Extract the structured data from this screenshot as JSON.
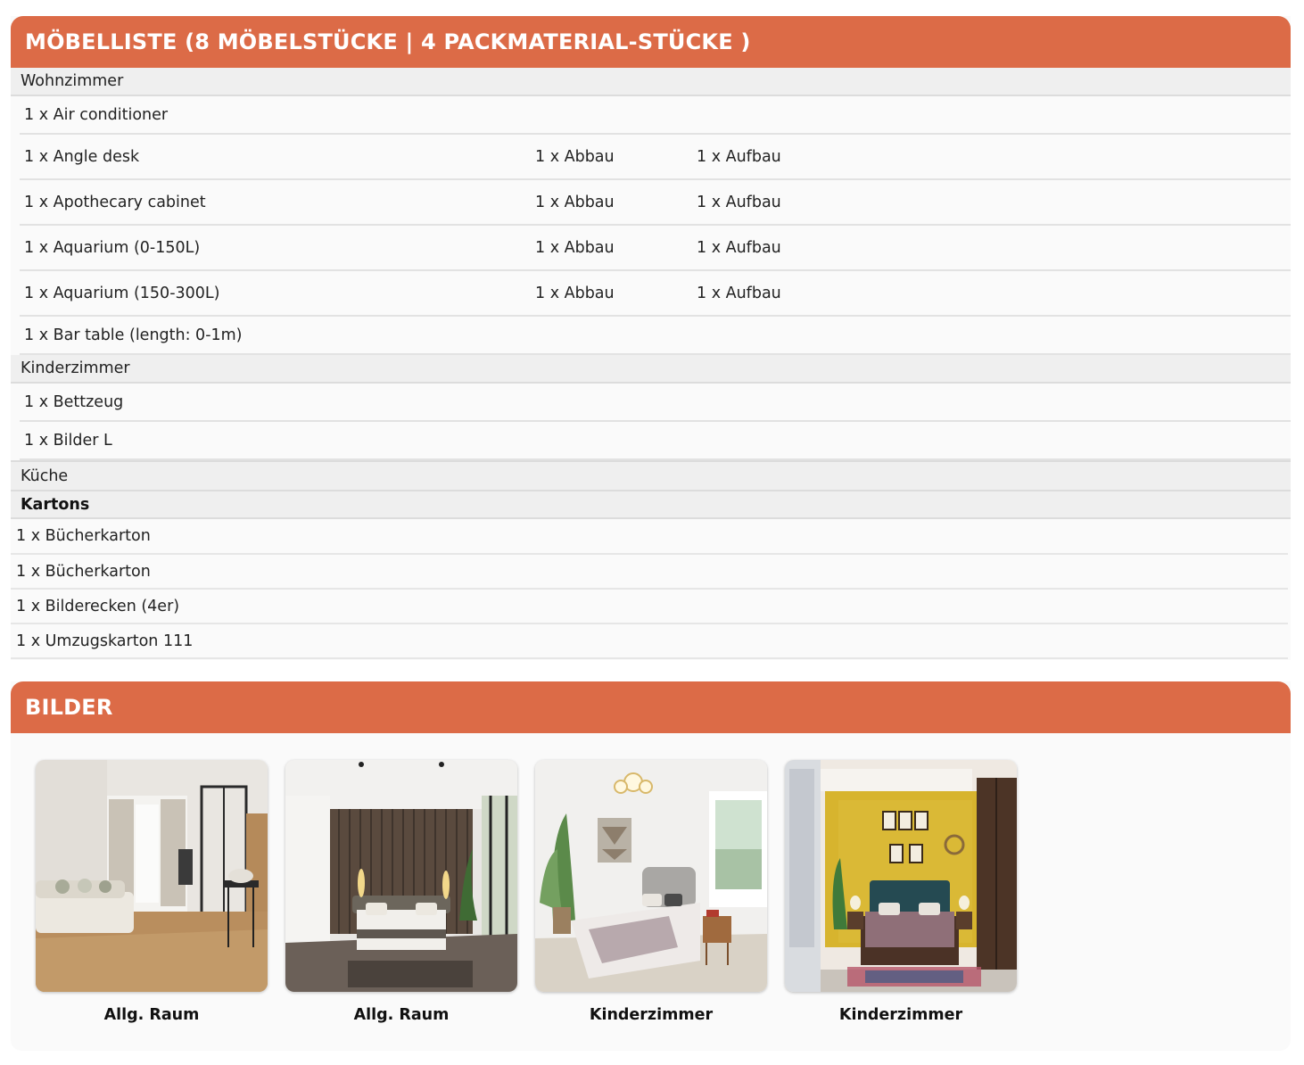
{
  "moebelliste": {
    "title": "MÖBELLISTE (8 MÖBELSTÜCKE | 4 PACKMATERIAL-STÜCKE )",
    "rooms": [
      {
        "name": "Wohnzimmer",
        "items": [
          {
            "label": "1 x Air conditioner",
            "abbau": "",
            "aufbau": ""
          },
          {
            "label": "1 x Angle desk",
            "abbau": "1 x Abbau",
            "aufbau": "1 x Aufbau"
          },
          {
            "label": "1 x Apothecary cabinet",
            "abbau": "1 x Abbau",
            "aufbau": "1 x Aufbau"
          },
          {
            "label": "1 x Aquarium (0-150L)",
            "abbau": "1 x Abbau",
            "aufbau": "1 x Aufbau"
          },
          {
            "label": "1 x Aquarium (150-300L)",
            "abbau": "1 x Abbau",
            "aufbau": "1 x Aufbau"
          },
          {
            "label": "1 x Bar table (length: 0-1m)",
            "abbau": "",
            "aufbau": ""
          }
        ]
      },
      {
        "name": "Kinderzimmer",
        "items": [
          {
            "label": "1 x Bettzeug",
            "abbau": "",
            "aufbau": ""
          },
          {
            "label": "1 x Bilder L",
            "abbau": "",
            "aufbau": ""
          }
        ]
      },
      {
        "name": "Küche",
        "items": []
      }
    ],
    "kartons": {
      "label": "Kartons",
      "items": [
        "1 x Bücherkarton",
        "1 x Bücherkarton",
        "1 x Bilderecken (4er)",
        "1 x Umzugskarton 111"
      ]
    }
  },
  "bilder": {
    "title": "BILDER",
    "photos": [
      {
        "caption": "Allg. Raum",
        "scene": "living-room"
      },
      {
        "caption": "Allg. Raum",
        "scene": "bedroom-dark-panels"
      },
      {
        "caption": "Kinderzimmer",
        "scene": "bedroom-bright"
      },
      {
        "caption": "Kinderzimmer",
        "scene": "bedroom-yellow-wall"
      }
    ]
  },
  "colors": {
    "accent": "#dc6b47",
    "panel_bg": "#fafafa",
    "room_bg": "#efefef"
  }
}
